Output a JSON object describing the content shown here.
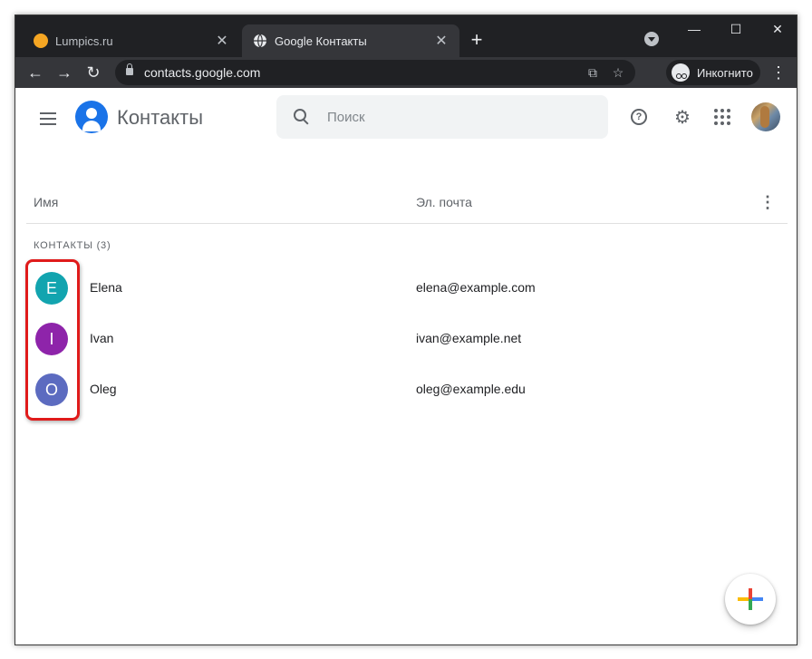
{
  "browser": {
    "tabs": [
      {
        "title": "Lumpics.ru",
        "favicon_color": "#f5a623",
        "active": false
      },
      {
        "title": "Google Контакты",
        "active": true
      }
    ],
    "new_tab": "+",
    "window_controls": {
      "minimize": "—",
      "maximize": "☐",
      "close": "✕"
    },
    "close_glyph": "✕",
    "nav": {
      "back": "←",
      "forward": "→",
      "reload": "↻"
    },
    "url": "contacts.google.com",
    "incognito_label": "Инкогнито",
    "menu_glyph": "⋮",
    "translate_glyph": "⧉",
    "bookmark_glyph": "☆"
  },
  "header": {
    "title": "Контакты",
    "search_placeholder": "Поиск",
    "help_glyph": "?",
    "settings_glyph": "⚙"
  },
  "table": {
    "col_name": "Имя",
    "col_email": "Эл. почта",
    "more_glyph": "⋮",
    "group_label": "КОНТАКТЫ (3)",
    "contacts": [
      {
        "initial": "E",
        "name": "Elena",
        "email": "elena@example.com",
        "color": "#12a4af"
      },
      {
        "initial": "I",
        "name": "Ivan",
        "email": "ivan@example.net",
        "color": "#8e24aa"
      },
      {
        "initial": "O",
        "name": "Oleg",
        "email": "oleg@example.edu",
        "color": "#5c6bc0"
      }
    ]
  },
  "colors": {
    "highlight": "#e01b1b",
    "fab_red": "#ea4335",
    "fab_blue": "#4285f4",
    "fab_green": "#34a853",
    "fab_yellow": "#fbbc04"
  }
}
